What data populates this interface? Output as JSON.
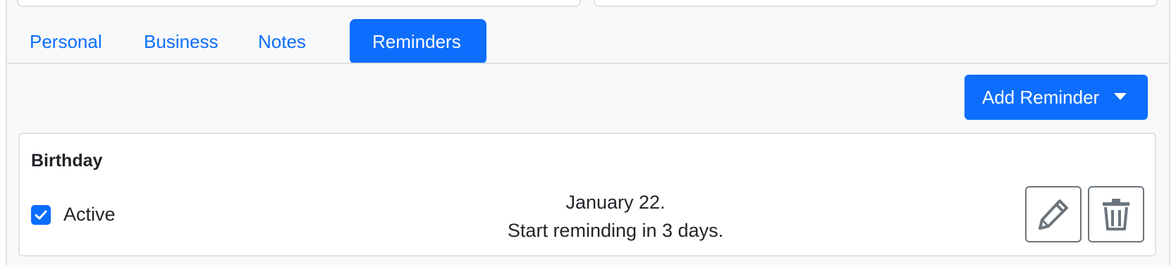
{
  "tabs": [
    {
      "label": "Personal",
      "active": false
    },
    {
      "label": "Business",
      "active": false
    },
    {
      "label": "Notes",
      "active": false
    },
    {
      "label": "Reminders",
      "active": true
    }
  ],
  "toolbar": {
    "add_reminder_label": "Add Reminder"
  },
  "reminder": {
    "title": "Birthday",
    "active_checked": true,
    "active_label": "Active",
    "date_text": "January 22.",
    "remind_text": "Start reminding in 3 days.",
    "edit_icon": "pencil-icon",
    "delete_icon": "trash-icon"
  },
  "colors": {
    "accent": "#0d6efd",
    "panel_bg": "#f8f9fa",
    "border": "#dee2e6",
    "icon_gray": "#6c757d"
  }
}
